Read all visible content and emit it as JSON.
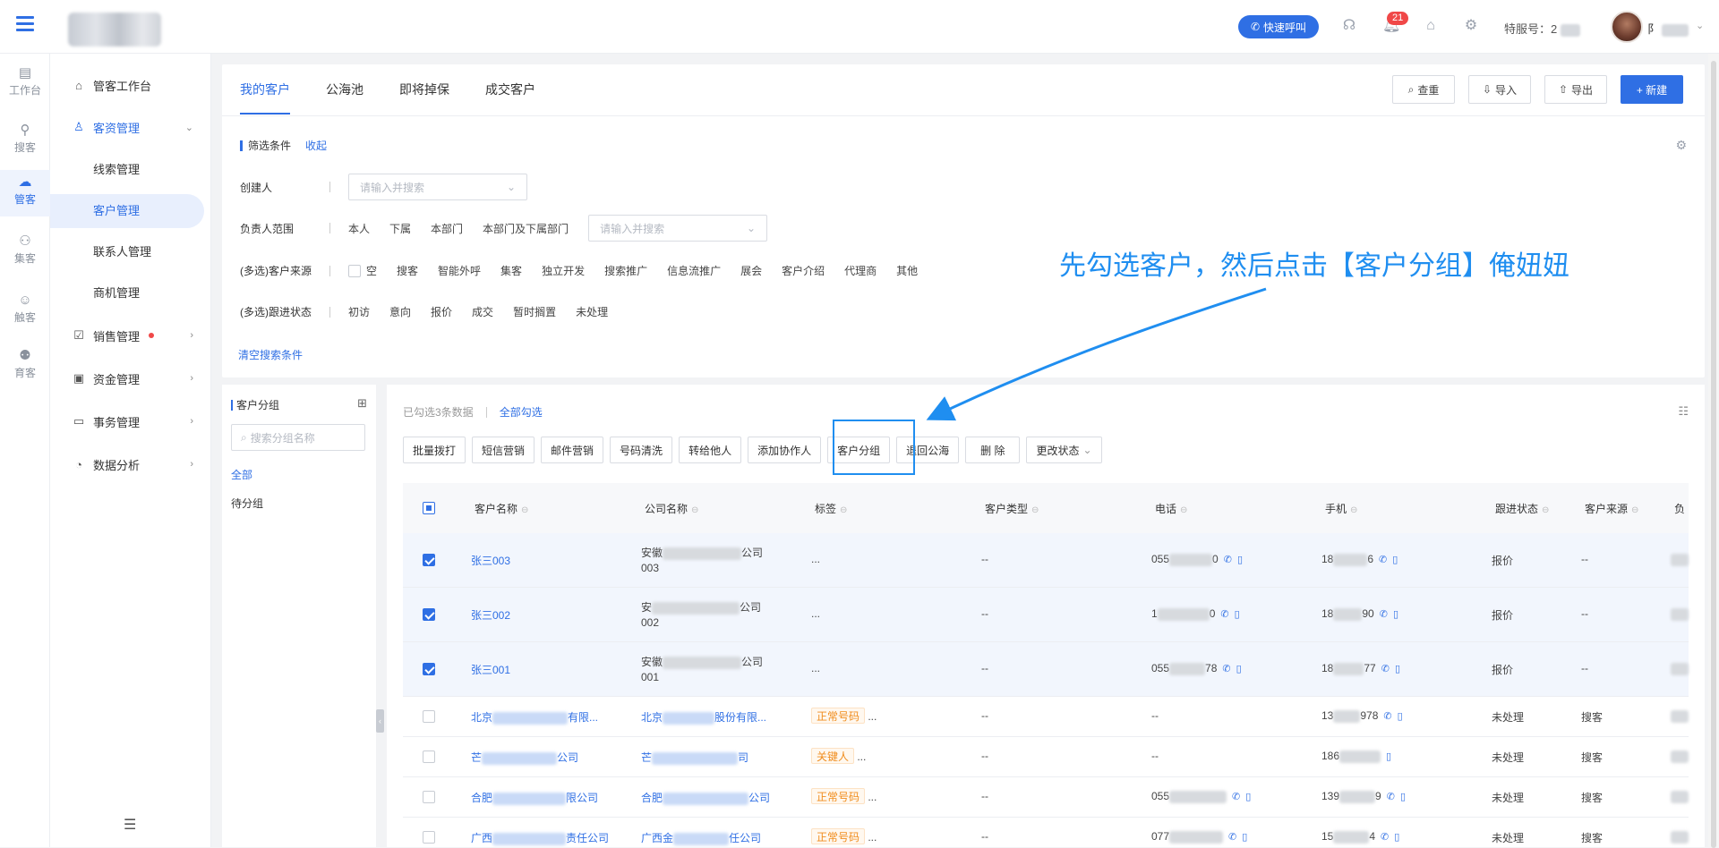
{
  "topbar": {
    "quick_call": "快速呼叫",
    "notif_count": "21",
    "agent_no_label": "特服号：2",
    "user_name_initial": "阝"
  },
  "rail": [
    {
      "label": "工作台",
      "icon": "workbench-icon"
    },
    {
      "label": "搜客",
      "icon": "search-customer-icon"
    },
    {
      "label": "管客",
      "icon": "crm-icon"
    },
    {
      "label": "集客",
      "icon": "group-icon"
    },
    {
      "label": "触客",
      "icon": "contact-icon"
    },
    {
      "label": "育客",
      "icon": "nurture-icon"
    }
  ],
  "menu": {
    "workbench": "管客工作台",
    "customer_mgmt": "客资管理",
    "sub": [
      "线索管理",
      "客户管理",
      "联系人管理",
      "商机管理"
    ],
    "sales": "销售管理",
    "finance": "资金管理",
    "affairs": "事务管理",
    "analytics": "数据分析"
  },
  "tabs": [
    "我的客户",
    "公海池",
    "即将掉保",
    "成交客户"
  ],
  "toolbar": {
    "dedupe": "查重",
    "import": "导入",
    "export": "导出",
    "new": "+ 新建"
  },
  "filter": {
    "title": "筛选条件",
    "collapse": "收起",
    "creator_label": "创建人",
    "placeholder": "请输入并搜索",
    "owner_label": "负责人范围",
    "owner_opts": [
      "本人",
      "下属",
      "本部门",
      "本部门及下属部门"
    ],
    "source_label": "(多选)客户来源",
    "source_opts": [
      "空",
      "搜客",
      "智能外呼",
      "集客",
      "独立开发",
      "搜索推广",
      "信息流推广",
      "展会",
      "客户介绍",
      "代理商",
      "其他"
    ],
    "status_label": "(多选)跟进状态",
    "status_opts": [
      "初访",
      "意向",
      "报价",
      "成交",
      "暂时搁置",
      "未处理"
    ],
    "clear": "清空搜索条件"
  },
  "groups": {
    "title": "客户分组",
    "search_placeholder": "搜索分组名称",
    "all": "全部",
    "pending": "待分组"
  },
  "list": {
    "selected_info": "已勾选3条数据",
    "select_all": "全部勾选",
    "actions": [
      "批量拨打",
      "短信营销",
      "邮件营销",
      "号码清洗",
      "转给他人",
      "添加协作人",
      "客户分组",
      "退回公海",
      "删 除",
      "更改状态"
    ],
    "columns": [
      "客户名称",
      "公司名称",
      "标签",
      "客户类型",
      "电话",
      "手机",
      "跟进状态",
      "客户来源",
      "负"
    ],
    "rows": [
      {
        "name": "张三003",
        "company_a": "安徽",
        "company_b": "公司",
        "company_c": "003",
        "tag": "...",
        "type": "--",
        "phone_a": "055",
        "phone_b": "0",
        "mobile_a": "18",
        "mobile_b": "6",
        "status": "报价",
        "source": "--"
      },
      {
        "name": "张三002",
        "company_a": "安",
        "company_b": "公司",
        "company_c": "002",
        "tag": "...",
        "type": "--",
        "phone_a": "1",
        "phone_b": "0",
        "mobile_a": "18",
        "mobile_b": "90",
        "status": "报价",
        "source": "--"
      },
      {
        "name": "张三001",
        "company_a": "安徽",
        "company_b": "公司",
        "company_c": "001",
        "tag": "...",
        "type": "--",
        "phone_a": "055",
        "phone_b": "78",
        "mobile_a": "18",
        "mobile_b": "77",
        "status": "报价",
        "source": "--"
      },
      {
        "name_a": "北京",
        "name_b": "有限...",
        "company_a": "北京",
        "company_b": "股份有限...",
        "tag": "正常号码",
        "type": "--",
        "phone": "--",
        "mobile_a": "13",
        "mobile_b": "978",
        "status": "未处理",
        "source": "搜客"
      },
      {
        "name_a": "芒",
        "name_b": "公司",
        "company_a": "芒",
        "company_b": "司",
        "tag": "关键人",
        "type": "--",
        "phone": "--",
        "mobile_a": "186",
        "mobile_b": "",
        "status": "未处理",
        "source": "搜客"
      },
      {
        "name_a": "合肥",
        "name_b": "限公司",
        "company_a": "合肥",
        "company_b": "公司",
        "tag": "正常号码",
        "type": "--",
        "phone_a": "055",
        "mobile_a": "139",
        "mobile_b": "9",
        "status": "未处理",
        "source": "搜客"
      },
      {
        "name_a": "广西",
        "name_b": "责任公司",
        "company_a": "广西金",
        "company_b": "任公司",
        "tag": "正常号码",
        "type": "--",
        "phone_a": "077",
        "mobile_a": "15",
        "mobile_b": "4",
        "status": "未处理",
        "source": "搜客"
      }
    ]
  },
  "annotation": "先勾选客户，然后点击【客户分组】俺妞妞",
  "colors": {
    "accent": "#2f6fe4",
    "annotation": "#1f8ef0",
    "tag_orange": "#f08c1c"
  }
}
